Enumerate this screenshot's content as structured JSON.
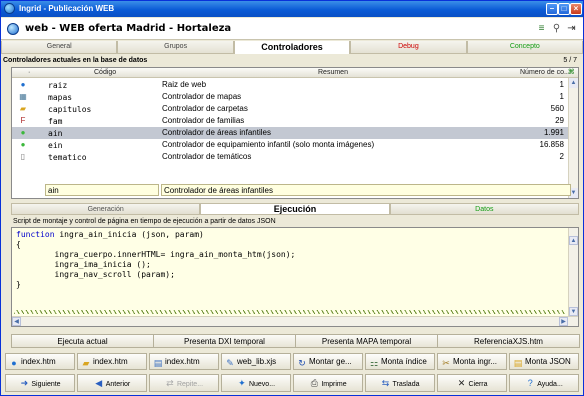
{
  "window": {
    "title": "Ingrid - Publicación WEB"
  },
  "header": {
    "title": "web - WEB oferta Madrid - Hortaleza"
  },
  "tabs": [
    {
      "label": "General"
    },
    {
      "label": "Grupos"
    },
    {
      "label": "Controladores"
    },
    {
      "label": "Debug"
    },
    {
      "label": "Concepto"
    }
  ],
  "section": {
    "label": "Controladores actuales en la base de datos",
    "count": "5 / 7"
  },
  "table": {
    "columns": {
      "code": "Código",
      "summary": "Resumen",
      "number": "Número de co..."
    },
    "rows": [
      {
        "icon": "globe-icon",
        "code": "raiz",
        "summary": "Raiz de web",
        "number": "1"
      },
      {
        "icon": "map-icon",
        "code": "mapas",
        "summary": "Controlador de mapas",
        "number": "1"
      },
      {
        "icon": "folder-icon",
        "code": "capitulos",
        "summary": "Controlador de carpetas",
        "number": "560"
      },
      {
        "icon": "family-icon",
        "code": "fam",
        "summary": "Controlador de familias",
        "number": "29"
      },
      {
        "icon": "green-dot-icon",
        "code": "ain",
        "summary": "Controlador de áreas infantiles",
        "number": "1.991"
      },
      {
        "icon": "green-dot-icon",
        "code": "ein",
        "summary": "Controlador de equipamiento infantil (solo monta imágenes)",
        "number": "16.858"
      },
      {
        "icon": "page-icon",
        "code": "tematico",
        "summary": "Controlador de temáticos",
        "number": "2"
      }
    ],
    "selected_index": 4
  },
  "selection": {
    "code": "ain",
    "summary": "Controlador de áreas infantiles"
  },
  "subtabs": [
    {
      "label": "Generación"
    },
    {
      "label": "Ejecución"
    },
    {
      "label": "Datos"
    }
  ],
  "script": {
    "label": "Script de montaje y control de página en tiempo de ejecución a partir de datos JSON",
    "lines": [
      {
        "kw": "function",
        "text": " ingra_ain_inicia (json, param)"
      },
      {
        "kw": "",
        "text": "{"
      },
      {
        "kw": "",
        "text": "        ingra_cuerpo.innerHTML= ingra_ain_monta_htm(json);"
      },
      {
        "kw": "",
        "text": "        ingra_ima_inicia ();"
      },
      {
        "kw": "",
        "text": "        ingra_nav_scroll (param);"
      },
      {
        "kw": "",
        "text": "}"
      }
    ]
  },
  "actions": [
    {
      "label": "Ejecuta actual"
    },
    {
      "label": "Presenta DXI temporal"
    },
    {
      "label": "Presenta MAPA temporal"
    },
    {
      "label": "ReferenciaXJS.htm"
    }
  ],
  "files": [
    {
      "icon": "globe-icon",
      "label": "index.htm"
    },
    {
      "icon": "folder-icon",
      "label": "index.htm"
    },
    {
      "icon": "document-icon",
      "label": "index.htm"
    },
    {
      "icon": "edit-icon",
      "label": "web_lib.xjs"
    },
    {
      "icon": "refresh-icon",
      "label": "Montar ge..."
    },
    {
      "icon": "tree-icon",
      "label": "Monta índice"
    },
    {
      "icon": "tool-icon",
      "label": "Monta ingr..."
    },
    {
      "icon": "json-icon",
      "label": "Monta JSON"
    }
  ],
  "nav": [
    {
      "icon": "arrow-right-icon",
      "label": "Siguiente",
      "enabled": true
    },
    {
      "icon": "arrow-left-icon",
      "label": "Anterior",
      "enabled": true
    },
    {
      "icon": "repeat-icon",
      "label": "Repite...",
      "enabled": false
    },
    {
      "icon": "new-icon",
      "label": "Nuevo...",
      "enabled": true
    },
    {
      "icon": "printer-icon",
      "label": "Imprime",
      "enabled": true
    },
    {
      "icon": "transfer-icon",
      "label": "Traslada",
      "enabled": true
    },
    {
      "icon": "close-icon",
      "label": "Cierra",
      "enabled": true
    },
    {
      "icon": "help-icon",
      "label": "Ayuda...",
      "enabled": true
    }
  ]
}
